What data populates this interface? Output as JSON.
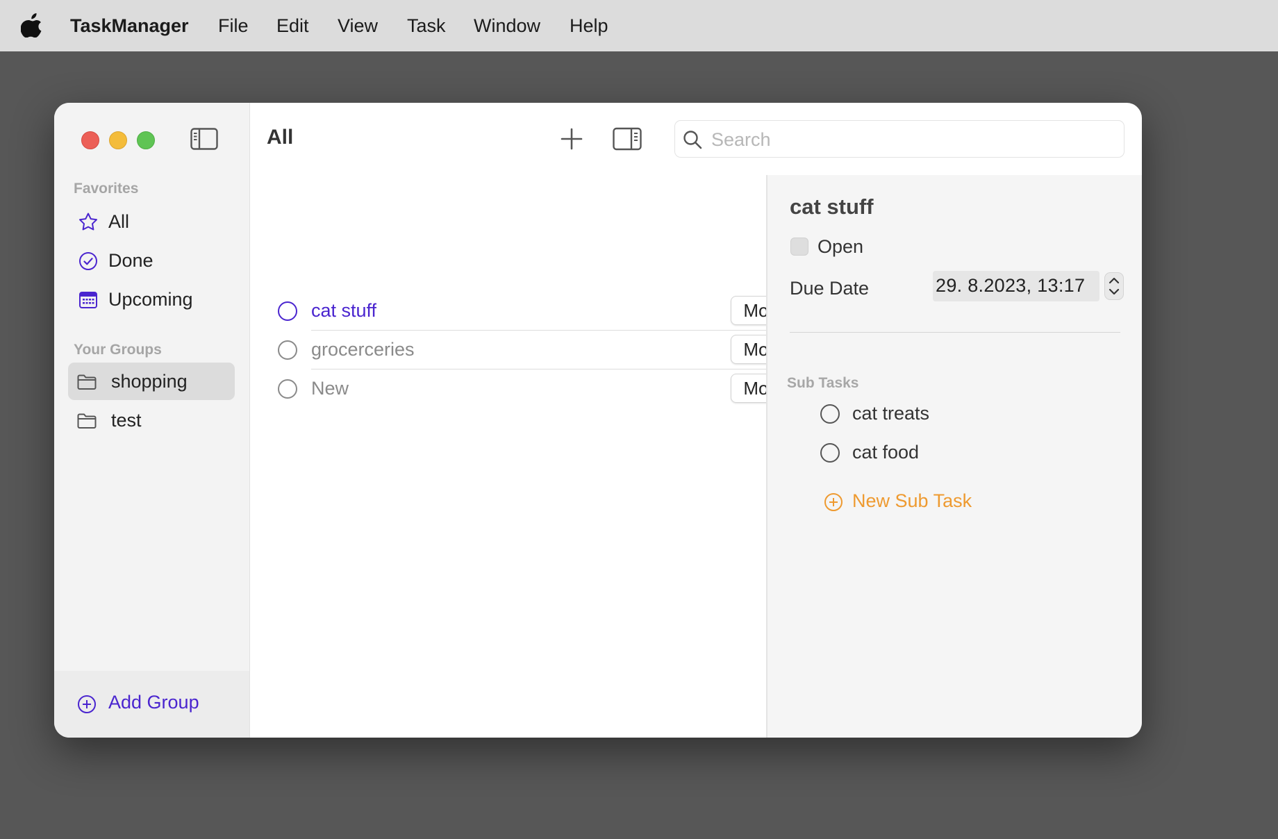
{
  "menubar": {
    "app_name": "TaskManager",
    "items": [
      "File",
      "Edit",
      "View",
      "Task",
      "Window",
      "Help"
    ]
  },
  "sidebar": {
    "favorites_label": "Favorites",
    "favorites": [
      {
        "label": "All",
        "icon": "star-icon"
      },
      {
        "label": "Done",
        "icon": "checkmark-circle-icon"
      },
      {
        "label": "Upcoming",
        "icon": "calendar-icon"
      }
    ],
    "groups_label": "Your Groups",
    "groups": [
      {
        "label": "shopping",
        "icon": "folder-icon",
        "selected": true
      },
      {
        "label": "test",
        "icon": "folder-icon",
        "selected": false
      }
    ],
    "add_group_label": "Add Group"
  },
  "toolbar": {
    "title": "All",
    "search_placeholder": "Search"
  },
  "tasks": [
    {
      "name": "cat stuff",
      "more_label": "More",
      "active": true
    },
    {
      "name": "grocerceries",
      "more_label": "More",
      "active": false
    },
    {
      "name": "New",
      "more_label": "More",
      "active": false
    }
  ],
  "detail": {
    "title": "cat stuff",
    "status_label": "Open",
    "due_label": "Due Date",
    "due_value": "29.  8.2023, 13:17",
    "subtasks_label": "Sub Tasks",
    "subtasks": [
      "cat treats",
      "cat food"
    ],
    "new_subtask_label": "New Sub Task"
  },
  "colors": {
    "accent": "#4a25cf",
    "orange": "#ee9a30",
    "close": "#ec5f57",
    "minimize": "#f4bc3a",
    "zoom": "#5fc454"
  }
}
